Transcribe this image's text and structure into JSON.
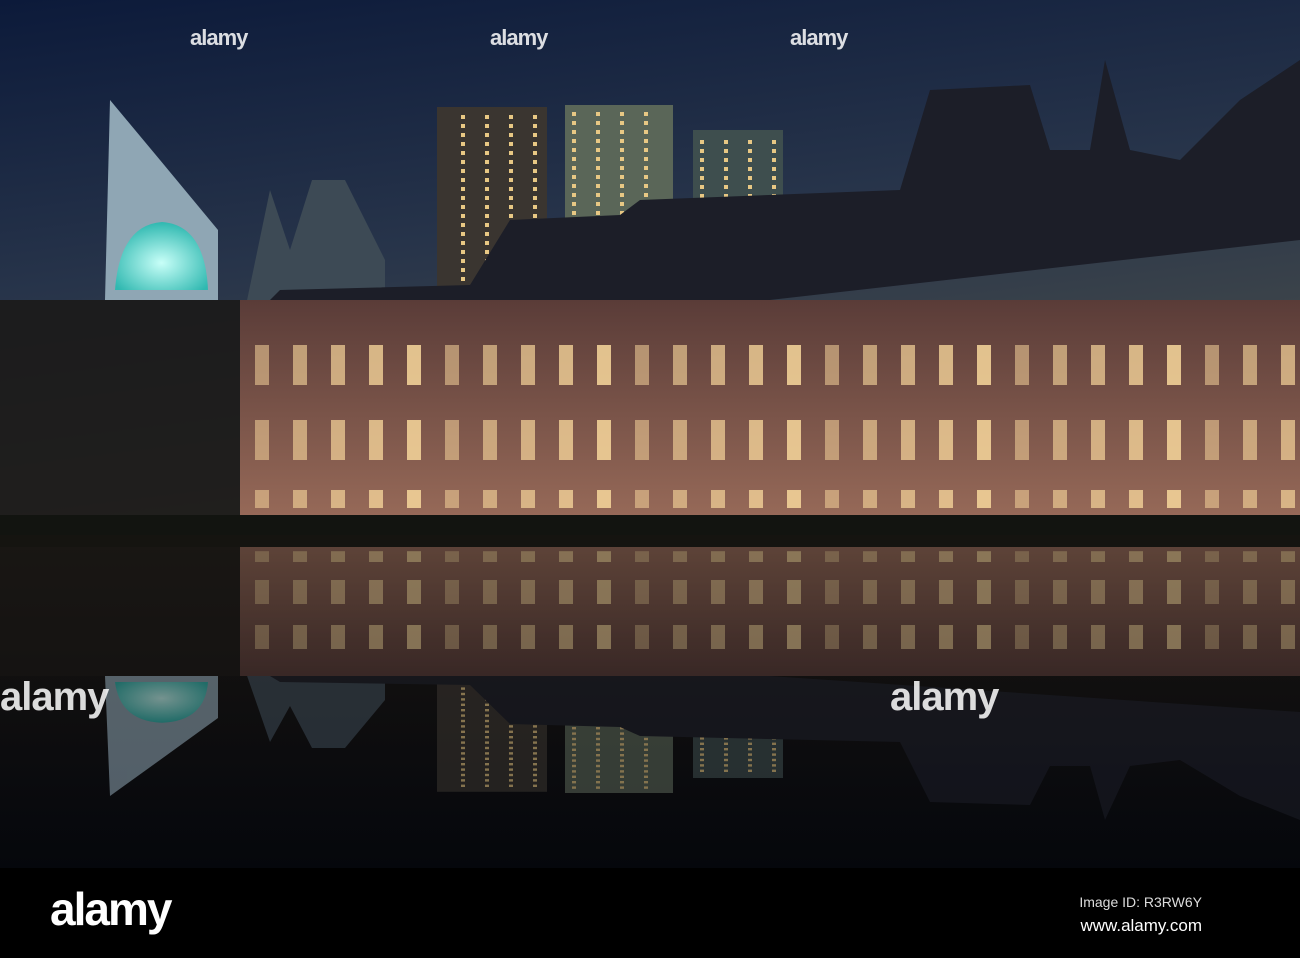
{
  "watermark": {
    "text": "alamy"
  },
  "footer": {
    "logo": "alamy",
    "image_id": "Image ID: R3RW6Y",
    "url": "www.alamy.com"
  },
  "colors": {
    "sky_top": "#0d1a33",
    "sky_bottom": "#3a4a55",
    "brick": "#7a5148",
    "roof": "#1d1f2a",
    "water": "#0a0c12",
    "glow": "#f5d49a",
    "dome": "#3fe0d8"
  }
}
